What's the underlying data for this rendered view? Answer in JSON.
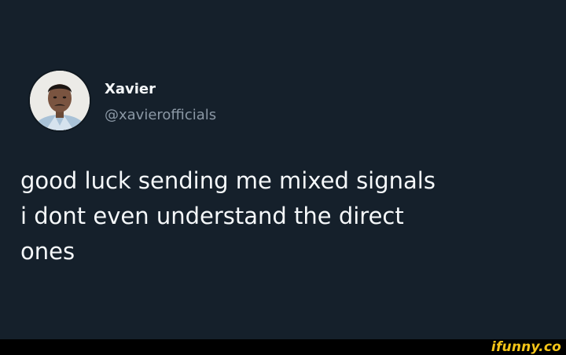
{
  "tweet": {
    "author": {
      "display_name": "Xavier",
      "handle": "@xavierofficials",
      "avatar": "profile-photo"
    },
    "text_lines": [
      "good luck sending me mixed signals",
      "i dont even understand the direct",
      "ones"
    ]
  },
  "watermark": {
    "text": "ifunny.co"
  },
  "colors": {
    "background": "#15202b",
    "primary_text": "#f5f8fa",
    "secondary_text": "#8b98a5",
    "footer_bar": "#000000",
    "watermark": "#f5c518"
  }
}
